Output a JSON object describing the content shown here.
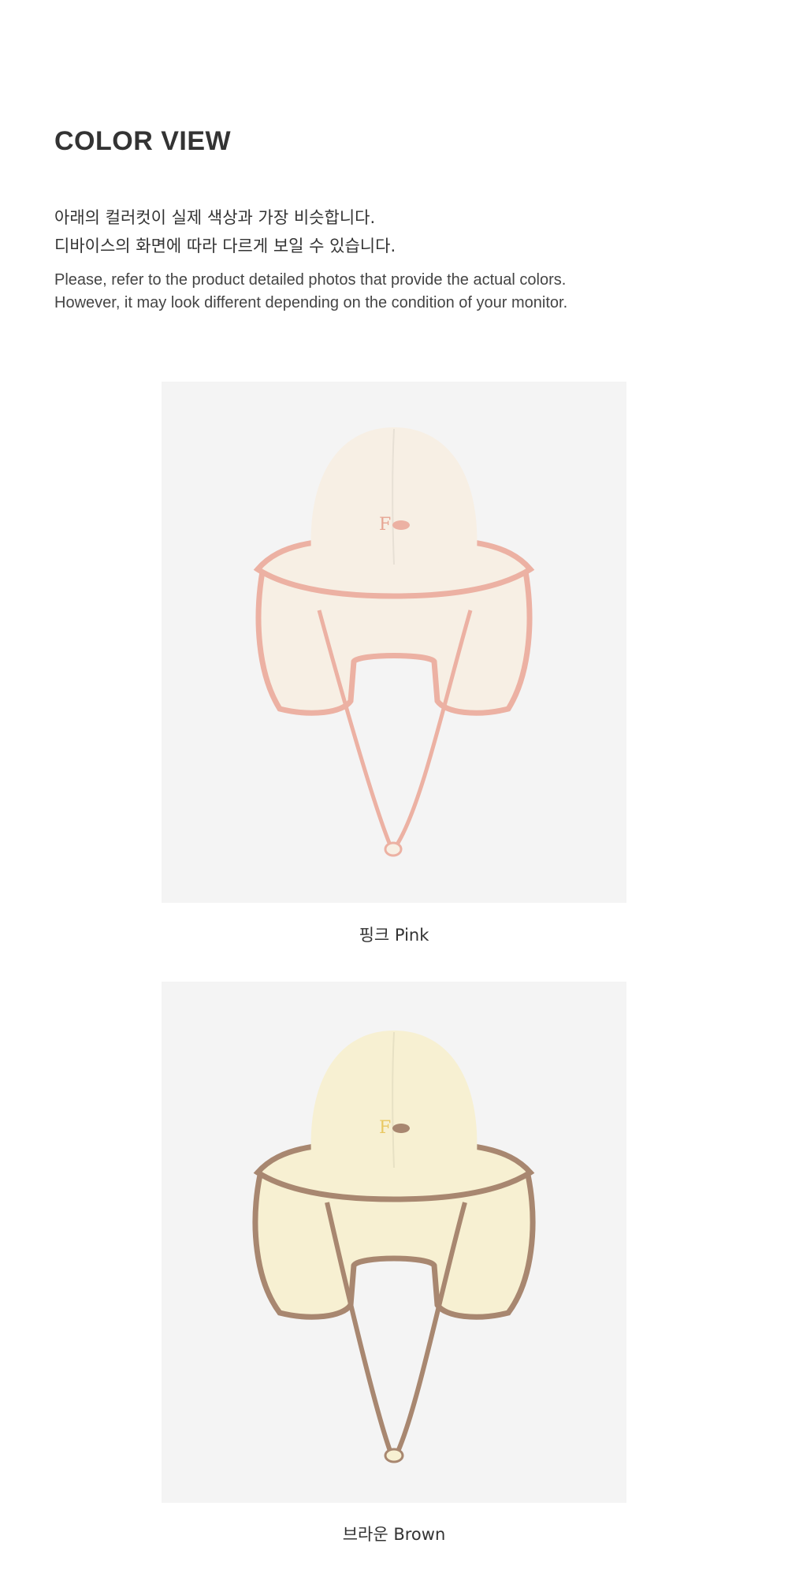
{
  "header": {
    "title": "COLOR VIEW"
  },
  "notice": {
    "ko_lines": [
      "아래의 컬러컷이 실제 색상과 가장 비슷합니다.",
      "디바이스의 화면에 따라 다르게 보일 수 있습니다."
    ],
    "en_lines": [
      "Please, refer to the product detailed photos that provide the actual colors.",
      "However, it may look different depending on the condition of your monitor."
    ]
  },
  "colors": [
    {
      "caption": "핑크 Pink",
      "hat_color": "#f7efe4",
      "trim_color": "#ecb1a3",
      "logo_color": "#e7a593"
    },
    {
      "caption": "브라운 Brown",
      "hat_color": "#f7f0d2",
      "trim_color": "#a88770",
      "logo_color": "#e9c862"
    }
  ]
}
